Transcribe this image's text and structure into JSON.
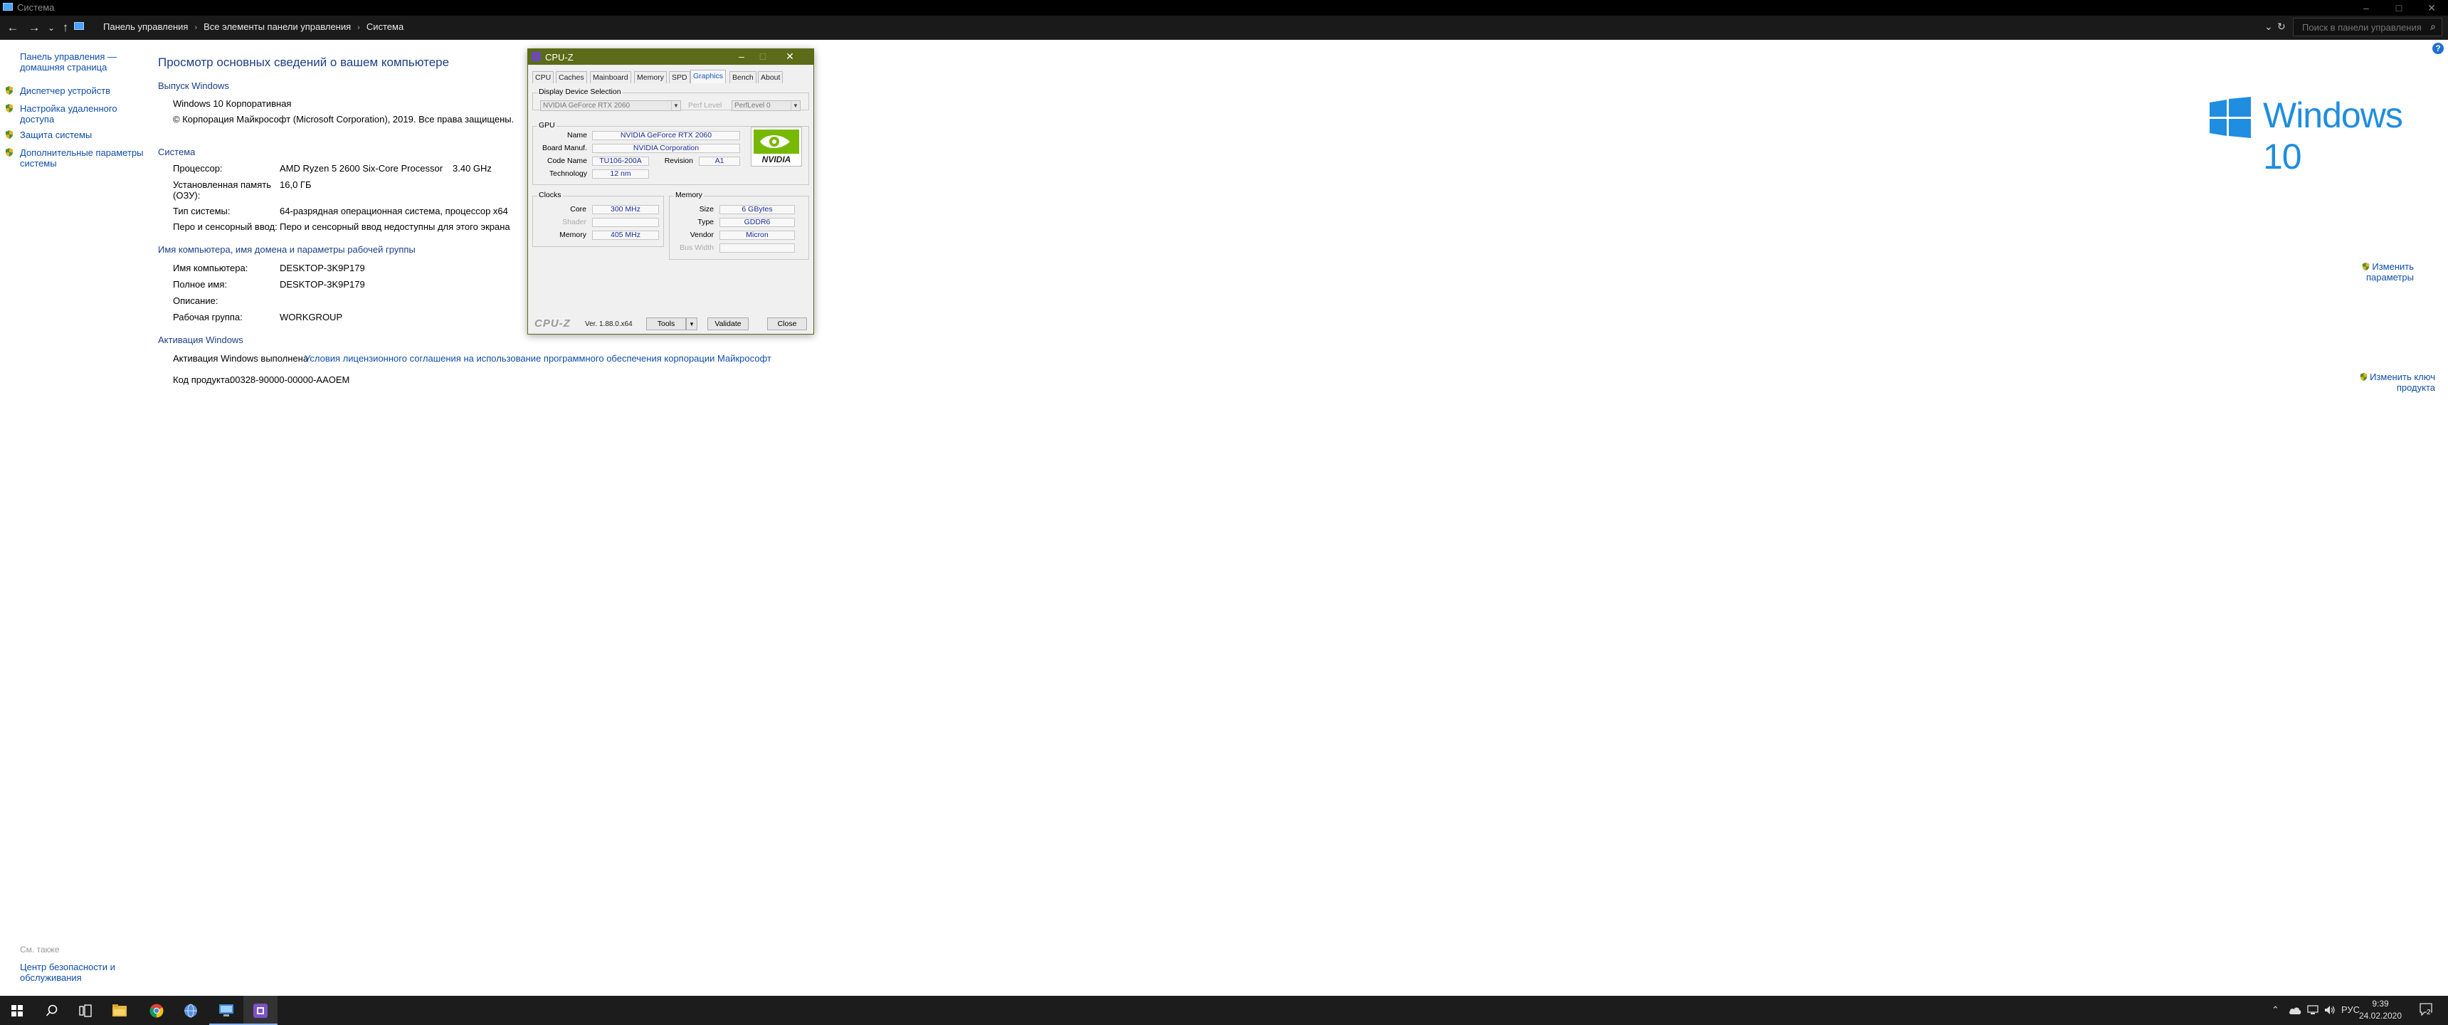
{
  "window": {
    "title": "Система",
    "controls": {
      "minimize": "–",
      "maximize": "□",
      "close": "✕"
    }
  },
  "address_bar": {
    "back": "←",
    "forward": "→",
    "recent": "⌄",
    "up": "↑",
    "crumbs": [
      "Панель управления",
      "Все элементы панели управления",
      "Система"
    ],
    "dropdown": "⌄",
    "refresh": "↻",
    "search_placeholder": "Поиск в панели управления"
  },
  "left_pane": {
    "home_link": "Панель управления — домашняя страница",
    "links": [
      "Диспетчер устройств",
      "Настройка удаленного доступа",
      "Защита системы",
      "Дополнительные параметры системы"
    ],
    "see_also": "См. также",
    "see_also_links": [
      "Центр безопасности и обслуживания"
    ]
  },
  "main": {
    "title": "Просмотр основных сведений о вашем компьютере",
    "edition": {
      "heading": "Выпуск Windows",
      "name": "Windows 10 Корпоративная",
      "copyright": "© Корпорация Майкрософт (Microsoft Corporation), 2019. Все права защищены."
    },
    "system": {
      "heading": "Система",
      "processor_label": "Процессор:",
      "processor_value": "AMD Ryzen 5 2600 Six-Core Processor",
      "processor_speed": "3.40 GHz",
      "ram_label": "Установленная память (ОЗУ):",
      "ram_value": "16,0 ГБ",
      "type_label": "Тип системы:",
      "type_value": "64-разрядная операционная система, процессор x64",
      "pen_label": "Перо и сенсорный ввод:",
      "pen_value": "Перо и сенсорный ввод недоступны для этого экрана"
    },
    "computer": {
      "heading": "Имя компьютера, имя домена и параметры рабочей группы",
      "name_label": "Имя компьютера:",
      "name_value": "DESKTOP-3K9P179",
      "full_label": "Полное имя:",
      "full_value": "DESKTOP-3K9P179",
      "desc_label": "Описание:",
      "desc_value": "",
      "group_label": "Рабочая группа:",
      "group_value": "WORKGROUP",
      "change_link": "Изменить параметры"
    },
    "activation": {
      "heading": "Активация Windows",
      "status": "Активация Windows выполнена",
      "license_link": "Условия лицензионного соглашения на использование программного обеспечения корпорации Майкрософт",
      "product_label": "Код продукта:",
      "product_value": "00328-90000-00000-AAOEM",
      "change_key_link": "Изменить ключ продукта"
    },
    "logo_text": "Windows 10"
  },
  "cpuz": {
    "title": "CPU-Z",
    "controls": {
      "minimize": "–",
      "maximize": "□",
      "close": "✕"
    },
    "tabs": [
      "CPU",
      "Caches",
      "Mainboard",
      "Memory",
      "SPD",
      "Graphics",
      "Bench",
      "About"
    ],
    "active_tab": "Graphics",
    "display_selection_title": "Display Device Selection",
    "device": "NVIDIA GeForce RTX 2060",
    "perf_level_label": "Perf Level",
    "perf_level_value": "PerfLevel 0",
    "gpu": {
      "title": "GPU",
      "name_label": "Name",
      "name_value": "NVIDIA GeForce RTX 2060",
      "board_label": "Board Manuf.",
      "board_value": "NVIDIA Corporation",
      "code_label": "Code Name",
      "code_value": "TU106-200A",
      "revision_label": "Revision",
      "revision_value": "A1",
      "tech_label": "Technology",
      "tech_value": "12 nm",
      "logo": "NVIDIA"
    },
    "clocks": {
      "title": "Clocks",
      "core_label": "Core",
      "core_value": "300 MHz",
      "shader_label": "Shader",
      "shader_value": "",
      "memory_label": "Memory",
      "memory_value": "405 MHz"
    },
    "memory": {
      "title": "Memory",
      "size_label": "Size",
      "size_value": "6 GBytes",
      "type_label": "Type",
      "type_value": "GDDR6",
      "vendor_label": "Vendor",
      "vendor_value": "Micron",
      "bus_label": "Bus Width",
      "bus_value": ""
    },
    "footer": {
      "brand": "CPU-Z",
      "version": "Ver. 1.88.0.x64",
      "tools": "Tools",
      "tools_arrow": "▾",
      "validate": "Validate",
      "close": "Close"
    }
  },
  "taskbar": {
    "start_icon": "windows-start-icon",
    "tray_arrow": "⌃",
    "language": "РУС",
    "time": "9:39",
    "date": "24.02.2020",
    "notification_count": "2"
  },
  "colors": {
    "link": "#0f4ea8",
    "heading": "#1e3f86",
    "windows_blue": "#1f8de0",
    "cpuz_title": "#5b6b18",
    "cpuz_value": "#1d2f9a"
  }
}
